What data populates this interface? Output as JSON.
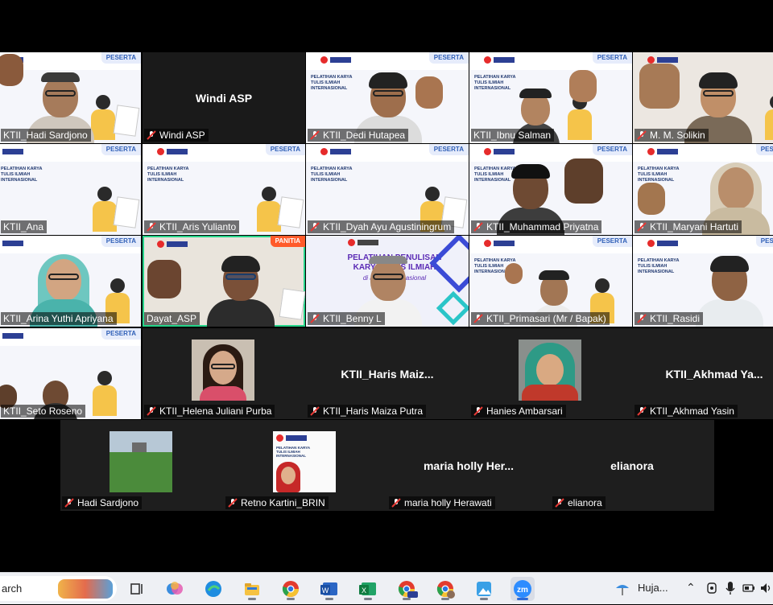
{
  "tiles": {
    "t1": {
      "name": "KTII_Hadi Sardjono",
      "badge": "PESERTA"
    },
    "t2": {
      "name": "Windi ASP",
      "center": "Windi ASP"
    },
    "t3": {
      "name": "KTII_Dedi Hutapea",
      "badge": "PESERTA",
      "slide": "PELATIHAN KARYA TULIS ILMIAH INTERNASIONAL"
    },
    "t4": {
      "name": "KTII_Ibnu Salman",
      "badge": "PESERTA",
      "slide": "PELATIHAN KARYA TULIS ILMIAH INTERNASIONAL"
    },
    "t5": {
      "name": "M. M. Solikin",
      "badge": "PE"
    },
    "t6": {
      "name": "KTII_Ana",
      "badge": "PESERTA",
      "slide": "PELATIHAN KARYA TULIS ILMIAH INTERNASIONAL"
    },
    "t7": {
      "name": "KTII_Aris Yulianto",
      "badge": "PESERTA",
      "slide": "PELATIHAN KARYA TULIS ILMIAH INTERNASIONAL"
    },
    "t8": {
      "name": "KTII_Dyah Ayu Agustiningrum",
      "badge": "PESERTA",
      "slide": "PELATIHAN KARYA TULIS ILMIAH INTERNASIONAL"
    },
    "t9": {
      "name": "KTII_Muhammad Priyatna",
      "badge": "PESERTA",
      "slide": "PELATIHAN KARYA TULIS ILMIAH INTERNASIONAL"
    },
    "t10": {
      "name": "KTII_Maryani Hartuti",
      "badge": "PESERTA",
      "slide": "PELATIHAN KARYA TULIS ILMIAH INTERNASIONAL"
    },
    "t11": {
      "name": "KTII_Arina Yuthi Apriyana",
      "badge": "PESERTA"
    },
    "t12": {
      "name": "Dayat_ASP",
      "badge": "PANITIA"
    },
    "t13": {
      "name": "KTII_Benny L",
      "slide": "PELATIHAN PENULISAN KARYA TULIS ILMIAH",
      "sub": "di Jurnal Internasional"
    },
    "t14": {
      "name": "KTII_Primasari (Mr / Bapak)",
      "badge": "PESERTA",
      "slide": "PELATIHAN KARYA TULIS ILMIAH INTERNASIONAL"
    },
    "t15": {
      "name": "KTII_Rasidi",
      "badge": "PESERTA",
      "slide": "PELATIHAN KARYA TULIS ILMIAH INTERNASIONAL"
    },
    "t16": {
      "name": "KTII_Seto Roseno",
      "badge": "PESERTA"
    },
    "t17": {
      "name": "KTII_Helena Juliani Purba"
    },
    "t18": {
      "name": "KTII_Haris Maiza Putra",
      "center": "KTII_Haris  Maiz..."
    },
    "t19": {
      "name": "Hanies Ambarsari"
    },
    "t20": {
      "name": "KTII_Akhmad Yasin",
      "center": "KTII_Akhmad  Ya..."
    },
    "t21": {
      "name": "Hadi Sardjono"
    },
    "t22": {
      "name": "Retno Kartini_BRIN",
      "slide": "PELATIHAN KARYA TULIS ILMIAH INTERNASIONAL"
    },
    "t23": {
      "name": "maria holly Herawati",
      "center": "maria  holly  Her..."
    },
    "t24": {
      "name": "elianora",
      "center": "elianora"
    }
  },
  "taskbar": {
    "search_label": "arch",
    "weather_label": "Huja...",
    "apps": [
      "task-view",
      "copilot",
      "edge",
      "file-explorer",
      "chrome",
      "word",
      "excel",
      "chrome-profile-rep",
      "chrome-profile-2",
      "photos",
      "zoom"
    ]
  },
  "colors": {
    "active_speaker": "#25d48a",
    "panitia": "#ff5a2a",
    "muted": "#e53935"
  }
}
